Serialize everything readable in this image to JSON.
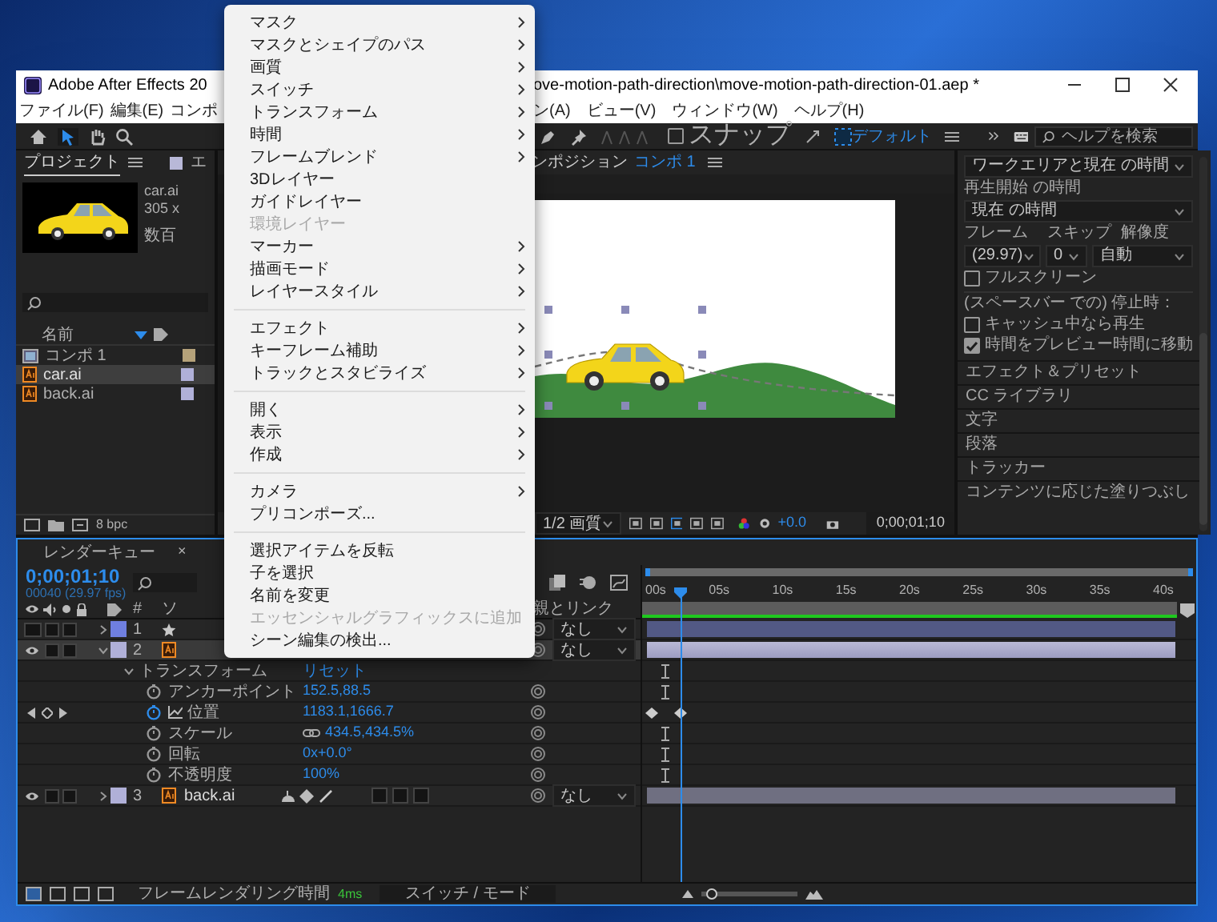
{
  "window": {
    "title_start": "Adobe After Effects 20",
    "title_end": "ove-motion-path-direction\\move-motion-path-direction-01.aep *"
  },
  "menubar": {
    "left": [
      "ファイル(F)",
      "編集(E)",
      "コンポ"
    ],
    "right": [
      "ン(A)",
      "ビュー(V)",
      "ウィンドウ(W)",
      "ヘルプ(H)"
    ]
  },
  "toolbar": {
    "snap": {
      "label": "スナップ",
      "checked": false
    },
    "workspace": "デフォルト",
    "search": {
      "placeholder": "ヘルプを検索"
    }
  },
  "project_panel": {
    "tab": "プロジェクト",
    "next_tab": "エ",
    "info": [
      "car.ai",
      "305 x",
      "数百"
    ],
    "name_column": "名前",
    "items": [
      {
        "name": "コンポ 1",
        "kind": "comp",
        "selected": false,
        "color": "#b5a27a"
      },
      {
        "name": "car.ai",
        "kind": "ai",
        "selected": true,
        "color": "#b0b0d8"
      },
      {
        "name": "back.ai",
        "kind": "ai",
        "selected": false,
        "color": "#b0b0d8"
      }
    ],
    "bit_depth": "8 bpc"
  },
  "composition_panel": {
    "tab_prefix": "ンポジション",
    "tab_name": "コンポ 1",
    "quality": "1/2 画質",
    "exposure": "+0.0",
    "timecode": "0;00;01;10"
  },
  "preview_panel": {
    "range": "ワークエリアと現在 の時間",
    "start_label": "再生開始 の時間",
    "start": "現在 の時間",
    "frame_label": "フレーム",
    "skip_label": "スキップ",
    "resolution_label": "解像度",
    "frame": "(29.97)",
    "skip": "0",
    "resolution": "自動",
    "fullscreen": {
      "label": "フルスクリーン",
      "checked": false
    },
    "stop_label": "(スペースバー での) 停止時：",
    "options": [
      {
        "label": "キャッシュ中なら再生",
        "checked": false
      },
      {
        "label": "時間をプレビュー時間に移動",
        "checked": true
      }
    ]
  },
  "panels": [
    "エフェクト＆プリセット",
    "CC ライブラリ",
    "文字",
    "段落",
    "トラッカー",
    "コンテンツに応じた塗りつぶし"
  ],
  "timeline": {
    "render_queue_tab": "レンダーキュー",
    "close_mark": "×",
    "timecode": "0;00;01;10",
    "frame_info": "00040 (29.97 fps)",
    "header": {
      "number": "#",
      "source": "ソ",
      "parent": "親とリンク"
    },
    "ruler": [
      "00s",
      "05s",
      "10s",
      "15s",
      "20s",
      "25s",
      "30s",
      "35s",
      "40s"
    ],
    "layers": [
      {
        "number": "1",
        "kind": "shape",
        "visible": false,
        "expanded": false,
        "selected": false,
        "color": "#6f7fe0",
        "parent": "なし"
      },
      {
        "number": "2",
        "kind": "ai",
        "visible": true,
        "expanded": true,
        "selected": true,
        "color": "#b0b0d8",
        "parent": "なし",
        "transform": {
          "label": "トランスフォーム",
          "reset": "リセット",
          "properties": [
            {
              "name": "アンカーポイント",
              "value": "152.5,88.5",
              "keyframed": false,
              "linked": false
            },
            {
              "name": "位置",
              "value": "1183.1,1666.7",
              "keyframed": true,
              "linked": false
            },
            {
              "name": "スケール",
              "value": "434.5,434.5%",
              "keyframed": false,
              "linked": true
            },
            {
              "name": "回転",
              "value": "0x+0.0°",
              "keyframed": false,
              "linked": false
            },
            {
              "name": "不透明度",
              "value": "100%",
              "keyframed": false,
              "linked": false
            }
          ]
        }
      },
      {
        "number": "3",
        "kind": "ai",
        "name": "back.ai",
        "visible": true,
        "expanded": false,
        "selected": false,
        "color": "#b0b0d8",
        "parent": "なし"
      }
    ],
    "footer": {
      "render_label": "フレームレンダリング時間",
      "render_time": "4ms",
      "toggle": "スイッチ / モード",
      "zoom": {
        "level": 0.05
      }
    }
  },
  "context_menu": [
    {
      "kind": "item",
      "label": "マスク",
      "submenu": true,
      "disabled": false
    },
    {
      "kind": "item",
      "label": "マスクとシェイプのパス",
      "submenu": true,
      "disabled": false
    },
    {
      "kind": "item",
      "label": "画質",
      "submenu": true,
      "disabled": false
    },
    {
      "kind": "item",
      "label": "スイッチ",
      "submenu": true,
      "disabled": false
    },
    {
      "kind": "item",
      "label": "トランスフォーム",
      "submenu": true,
      "disabled": false
    },
    {
      "kind": "item",
      "label": "時間",
      "submenu": true,
      "disabled": false
    },
    {
      "kind": "item",
      "label": "フレームブレンド",
      "submenu": true,
      "disabled": false
    },
    {
      "kind": "item",
      "label": "3Dレイヤー",
      "submenu": false,
      "disabled": false
    },
    {
      "kind": "item",
      "label": "ガイドレイヤー",
      "submenu": false,
      "disabled": false
    },
    {
      "kind": "item",
      "label": "環境レイヤー",
      "submenu": false,
      "disabled": true
    },
    {
      "kind": "item",
      "label": "マーカー",
      "submenu": true,
      "disabled": false
    },
    {
      "kind": "item",
      "label": "描画モード",
      "submenu": true,
      "disabled": false
    },
    {
      "kind": "item",
      "label": "レイヤースタイル",
      "submenu": true,
      "disabled": false
    },
    {
      "kind": "separator"
    },
    {
      "kind": "item",
      "label": "エフェクト",
      "submenu": true,
      "disabled": false
    },
    {
      "kind": "item",
      "label": "キーフレーム補助",
      "submenu": true,
      "disabled": false
    },
    {
      "kind": "item",
      "label": "トラックとスタビライズ",
      "submenu": true,
      "disabled": false
    },
    {
      "kind": "separator"
    },
    {
      "kind": "item",
      "label": "開く",
      "submenu": true,
      "disabled": false
    },
    {
      "kind": "item",
      "label": "表示",
      "submenu": true,
      "disabled": false
    },
    {
      "kind": "item",
      "label": "作成",
      "submenu": true,
      "disabled": false
    },
    {
      "kind": "separator"
    },
    {
      "kind": "item",
      "label": "カメラ",
      "submenu": true,
      "disabled": false
    },
    {
      "kind": "item",
      "label": "プリコンポーズ...",
      "submenu": false,
      "disabled": false
    },
    {
      "kind": "separator"
    },
    {
      "kind": "item",
      "label": "選択アイテムを反転",
      "submenu": false,
      "disabled": false
    },
    {
      "kind": "item",
      "label": "子を選択",
      "submenu": false,
      "disabled": false
    },
    {
      "kind": "item",
      "label": "名前を変更",
      "submenu": false,
      "disabled": false
    },
    {
      "kind": "item",
      "label": "エッセンシャルグラフィックスに追加",
      "submenu": false,
      "disabled": true
    },
    {
      "kind": "item",
      "label": "シーン編集の検出...",
      "submenu": false,
      "disabled": false
    }
  ]
}
